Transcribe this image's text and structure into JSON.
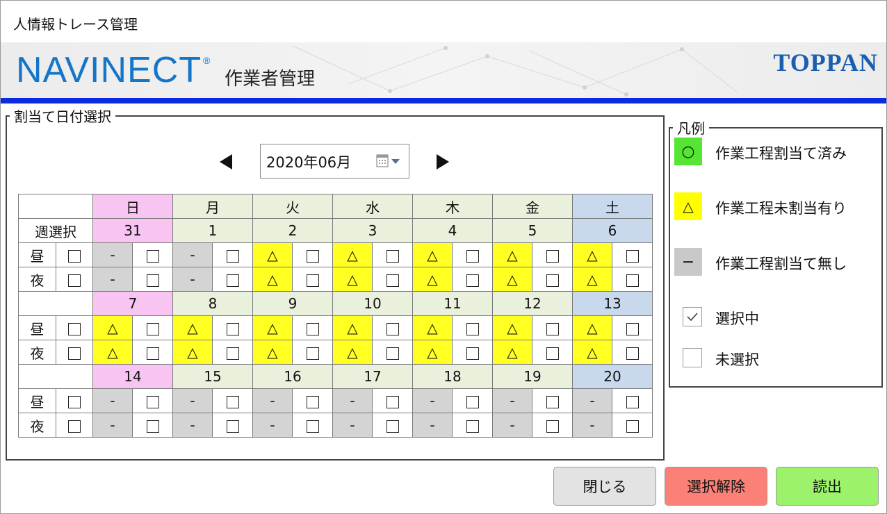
{
  "window": {
    "title": "人情報トレース管理"
  },
  "header": {
    "logo": "NAVINECT",
    "logo_mark": "®",
    "subtitle": "作業者管理",
    "brand": "TOPPAN"
  },
  "date_selection": {
    "legend": "割当て日付選択",
    "month_value": "2020年06月",
    "prev_icon": "triangle-left-icon",
    "next_icon": "triangle-right-icon",
    "week_select_label": "週選択",
    "shift_day": "昼",
    "shift_night": "夜",
    "weekdays": [
      "日",
      "月",
      "火",
      "水",
      "木",
      "金",
      "土"
    ],
    "weeks": [
      {
        "dates": [
          "31",
          "1",
          "2",
          "3",
          "4",
          "5",
          "6"
        ],
        "day_marks": [
          "-",
          "-",
          "△",
          "△",
          "△",
          "△",
          "△"
        ],
        "night_marks": [
          "-",
          "-",
          "△",
          "△",
          "△",
          "△",
          "△"
        ]
      },
      {
        "dates": [
          "7",
          "8",
          "9",
          "10",
          "11",
          "12",
          "13"
        ],
        "day_marks": [
          "△",
          "△",
          "△",
          "△",
          "△",
          "△",
          "△"
        ],
        "night_marks": [
          "△",
          "△",
          "△",
          "△",
          "△",
          "△",
          "△"
        ]
      },
      {
        "dates": [
          "14",
          "15",
          "16",
          "17",
          "18",
          "19",
          "20"
        ],
        "day_marks": [
          "-",
          "-",
          "-",
          "-",
          "-",
          "-",
          "-"
        ],
        "night_marks": [
          "-",
          "-",
          "-",
          "-",
          "-",
          "-",
          "-"
        ]
      }
    ]
  },
  "legend": {
    "title": "凡例",
    "assigned_symbol": "○",
    "assigned_label": "作業工程割当て済み",
    "unassigned_symbol": "△",
    "unassigned_label": "作業工程未割当有り",
    "none_symbol": "−",
    "none_label": "作業工程割当て無し",
    "selected_label": "選択中",
    "unselected_label": "未選択"
  },
  "buttons": {
    "close": "閉じる",
    "clear": "選択解除",
    "read": "読出"
  },
  "colors": {
    "sunday": "#f8c4f2",
    "weekday": "#e9f0dc",
    "saturday": "#c8d9ee",
    "unassigned": "#ffff22",
    "none": "#d4d4d4",
    "assigned": "#55e633",
    "clear_button": "#fb8077",
    "read_button": "#9df26b",
    "accent_bar": "#0a2be0"
  }
}
